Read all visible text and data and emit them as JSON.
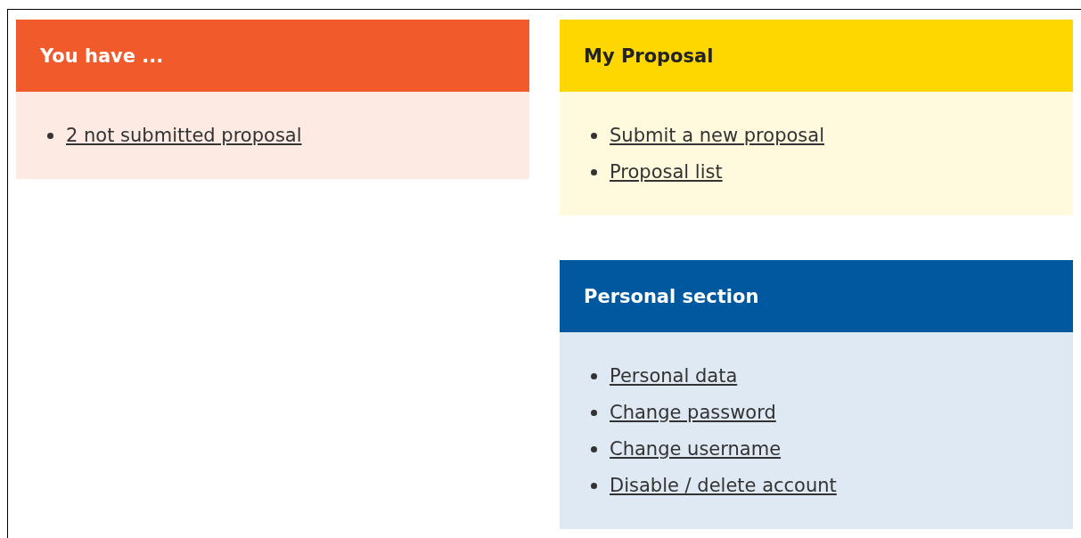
{
  "columns": [
    {
      "panels": [
        {
          "title": "You have ...",
          "color": "#f15a2b",
          "links": [
            "2 not submitted proposal"
          ]
        }
      ]
    },
    {
      "panels": [
        {
          "title": "My Proposal",
          "color": "#ffd700",
          "links": [
            "Submit a new proposal",
            "Proposal list"
          ]
        },
        {
          "title": "Personal section",
          "color": "#00589f",
          "links": [
            "Personal data",
            "Change password",
            "Change username",
            "Disable / delete account"
          ]
        }
      ]
    }
  ]
}
